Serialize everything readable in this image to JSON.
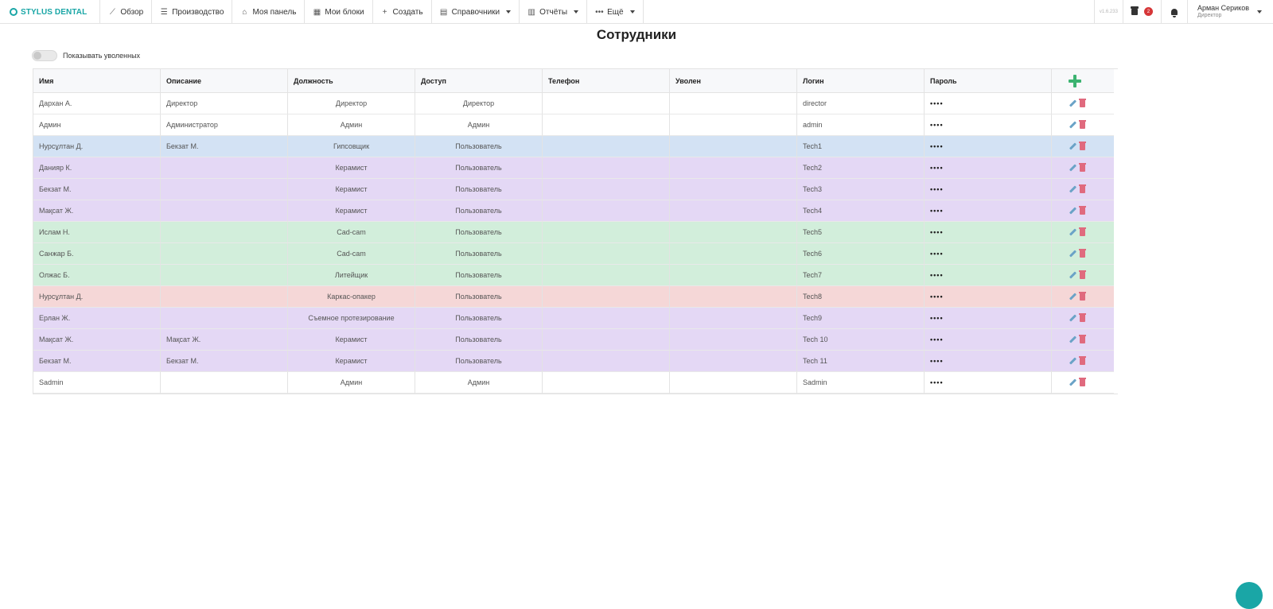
{
  "brand": {
    "name": "STYLUS DENTAL"
  },
  "nav": {
    "items": [
      {
        "label": "Обзор",
        "icon": "chart-line-icon",
        "glyph": "⟋",
        "dropdown": false
      },
      {
        "label": "Производство",
        "icon": "list-icon",
        "glyph": "☰",
        "dropdown": false
      },
      {
        "label": "Моя панель",
        "icon": "home-icon",
        "glyph": "⌂",
        "dropdown": false
      },
      {
        "label": "Мои блоки",
        "icon": "grid-icon",
        "glyph": "▦",
        "dropdown": false
      },
      {
        "label": "Создать",
        "icon": "plus-icon",
        "glyph": "+",
        "dropdown": false
      },
      {
        "label": "Справочники",
        "icon": "book-icon",
        "glyph": "▤",
        "dropdown": true
      },
      {
        "label": "Отчёты",
        "icon": "bar-chart-icon",
        "glyph": "▥",
        "dropdown": true
      },
      {
        "label": "Ещё",
        "icon": "ellipsis-icon",
        "glyph": "•••",
        "dropdown": true
      }
    ],
    "version": "v1.6.233",
    "notification_count": "2",
    "user_name": "Арман Сериков",
    "user_role": "Директор"
  },
  "page": {
    "title": "Сотрудники",
    "toggle_label": "Показывать уволенных"
  },
  "table": {
    "headers": [
      "Имя",
      "Описание",
      "Должность",
      "Доступ",
      "Телефон",
      "Уволен",
      "Логин",
      "Пароль"
    ],
    "rows": [
      {
        "name": "Дархан А.",
        "description": "Директор",
        "position": "Директор",
        "access": "Директор",
        "phone": "",
        "fired": "",
        "login": "director",
        "password": "••••",
        "color": "#ffffff"
      },
      {
        "name": "Админ",
        "description": "Администратор",
        "position": "Админ",
        "access": "Админ",
        "phone": "",
        "fired": "",
        "login": "admin",
        "password": "••••",
        "color": "#ffffff"
      },
      {
        "name": "Нурсұлтан Д.",
        "description": "Бекзат М.",
        "position": "Гипсовщик",
        "access": "Пользователь",
        "phone": "",
        "fired": "",
        "login": "Tech1",
        "password": "••••",
        "color": "#d3e2f4"
      },
      {
        "name": "Данияр К.",
        "description": "",
        "position": "Керамист",
        "access": "Пользователь",
        "phone": "",
        "fired": "",
        "login": "Tech2",
        "password": "••••",
        "color": "#e4d8f5"
      },
      {
        "name": "Бекзат М.",
        "description": "",
        "position": "Керамист",
        "access": "Пользователь",
        "phone": "",
        "fired": "",
        "login": "Tech3",
        "password": "••••",
        "color": "#e4d8f5"
      },
      {
        "name": "Мақсат Ж.",
        "description": "",
        "position": "Керамист",
        "access": "Пользователь",
        "phone": "",
        "fired": "",
        "login": "Tech4",
        "password": "••••",
        "color": "#e4d8f5"
      },
      {
        "name": "Ислам Н.",
        "description": "",
        "position": "Cad-cam",
        "access": "Пользователь",
        "phone": "",
        "fired": "",
        "login": "Tech5",
        "password": "••••",
        "color": "#d2eedb"
      },
      {
        "name": "Санжар Б.",
        "description": "",
        "position": "Cad-cam",
        "access": "Пользователь",
        "phone": "",
        "fired": "",
        "login": "Tech6",
        "password": "••••",
        "color": "#d2eedb"
      },
      {
        "name": "Олжас Б.",
        "description": "",
        "position": "Литейщик",
        "access": "Пользователь",
        "phone": "",
        "fired": "",
        "login": "Tech7",
        "password": "••••",
        "color": "#d2eedb"
      },
      {
        "name": "Нурсұлтан Д.",
        "description": "",
        "position": "Каркас-опакер",
        "access": "Пользователь",
        "phone": "",
        "fired": "",
        "login": "Tech8",
        "password": "••••",
        "color": "#f5d7d7"
      },
      {
        "name": "Ерлан Ж.",
        "description": "",
        "position": "Съемное протезирование",
        "access": "Пользователь",
        "phone": "",
        "fired": "",
        "login": "Tech9",
        "password": "••••",
        "color": "#e4d8f5"
      },
      {
        "name": "Мақсат Ж.",
        "description": "Мақсат Ж.",
        "position": "Керамист",
        "access": "Пользователь",
        "phone": "",
        "fired": "",
        "login": "Tech 10",
        "password": "••••",
        "color": "#e4d8f5"
      },
      {
        "name": "Бекзат М.",
        "description": "Бекзат М.",
        "position": "Керамист",
        "access": "Пользователь",
        "phone": "",
        "fired": "",
        "login": "Tech 11",
        "password": "••••",
        "color": "#e4d8f5"
      },
      {
        "name": "Sadmin",
        "description": "",
        "position": "Админ",
        "access": "Админ",
        "phone": "",
        "fired": "",
        "login": "Sadmin",
        "password": "••••",
        "color": "#ffffff"
      }
    ]
  }
}
